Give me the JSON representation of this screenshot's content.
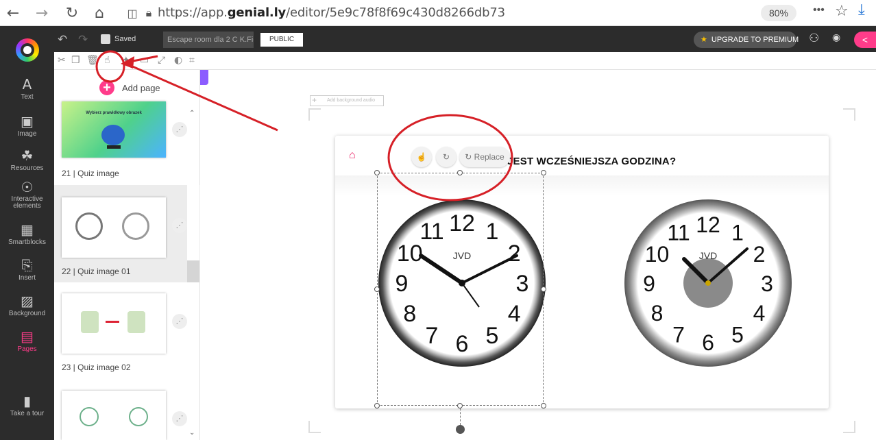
{
  "browser": {
    "url_prefix": "https://app.",
    "url_domain": "genial.ly",
    "url_path": "/editor/5e9c78f8f69c430d8266db73",
    "zoom": "80%",
    "more": "•••"
  },
  "appbar": {
    "saved_label": "Saved",
    "title_value": "Escape room dla 2 C K.Fie",
    "public_label": "PUBLIC",
    "upgrade_label": "UPGRADE TO PREMIUM"
  },
  "leftnav": {
    "items": [
      {
        "label": "Text",
        "icon": "A"
      },
      {
        "label": "Image",
        "icon": "▣"
      },
      {
        "label": "Resources",
        "icon": "☘"
      },
      {
        "label": "Interactive elements",
        "icon": "☉"
      },
      {
        "label": "Smartblocks",
        "icon": "▦"
      },
      {
        "label": "Insert",
        "icon": "⎘"
      },
      {
        "label": "Background",
        "icon": "▨"
      },
      {
        "label": "Pages",
        "icon": "▤"
      },
      {
        "label": "Take a tour",
        "icon": "▮"
      }
    ]
  },
  "pages": {
    "add_page": "Add page",
    "items": [
      {
        "label": "21 | Quiz image",
        "heading": "Wybierz prawidłowy obrazek"
      },
      {
        "label": "22 | Quiz image 01"
      },
      {
        "label": "23 | Quiz image 02"
      },
      {
        "label": ""
      }
    ]
  },
  "canvas": {
    "bg_placeholder": "Add background audio",
    "heading": "JEST WCZEŚNIEJSZA GODZINA?",
    "replace_label": "Replace",
    "clock_brand": "JVD",
    "clock_numbers": [
      "12",
      "1",
      "2",
      "3",
      "4",
      "5",
      "6",
      "7",
      "8",
      "9",
      "10",
      "11"
    ]
  },
  "colors": {
    "accent": "#ff3c8a",
    "dark": "#2c2c2c",
    "annotation": "#d62027"
  }
}
